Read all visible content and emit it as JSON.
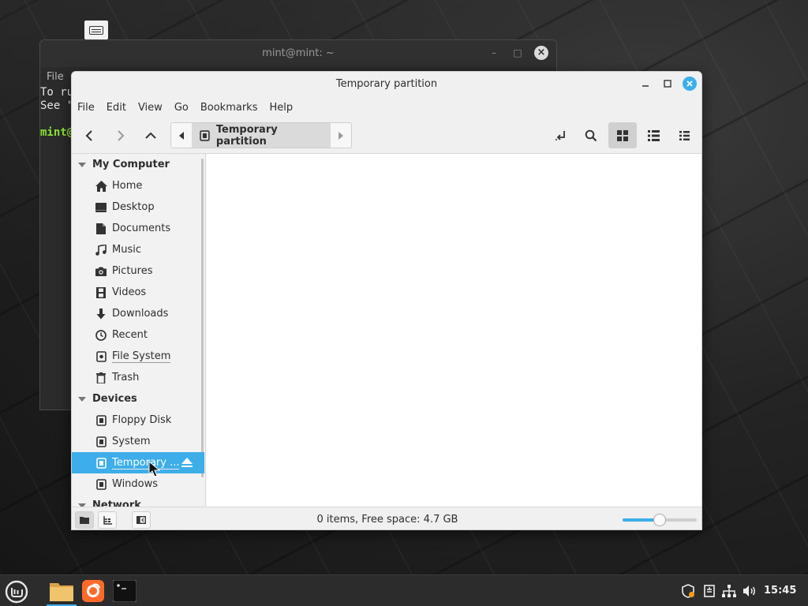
{
  "terminal": {
    "title": "mint@mint: ~",
    "menu_file": "File",
    "line1": "To ru",
    "line2": "See \"",
    "prompt": "mint@"
  },
  "window": {
    "title": "Temporary partition"
  },
  "menubar": {
    "items": [
      "File",
      "Edit",
      "View",
      "Go",
      "Bookmarks",
      "Help"
    ]
  },
  "toolbar": {
    "path_current": "Temporary partition",
    "active_view": "icon-view"
  },
  "sidebar": {
    "sections": [
      {
        "label": "My Computer",
        "items": [
          {
            "label": "Home",
            "icon": "home-icon"
          },
          {
            "label": "Desktop",
            "icon": "desktop-icon"
          },
          {
            "label": "Documents",
            "icon": "documents-icon"
          },
          {
            "label": "Music",
            "icon": "music-icon"
          },
          {
            "label": "Pictures",
            "icon": "camera-icon"
          },
          {
            "label": "Videos",
            "icon": "film-icon"
          },
          {
            "label": "Downloads",
            "icon": "download-arrow-icon"
          },
          {
            "label": "Recent",
            "icon": "clock-icon"
          },
          {
            "label": "File System",
            "icon": "drive-icon"
          },
          {
            "label": "Trash",
            "icon": "trash-icon"
          }
        ]
      },
      {
        "label": "Devices",
        "items": [
          {
            "label": "Floppy Disk",
            "icon": "drive-icon"
          },
          {
            "label": "System",
            "icon": "drive-icon"
          },
          {
            "label": "Temporary ...",
            "icon": "drive-icon",
            "selected": true
          },
          {
            "label": "Windows",
            "icon": "drive-icon"
          }
        ]
      },
      {
        "label": "Network",
        "items": []
      }
    ]
  },
  "status": {
    "text": "0 items, Free space: 4.7 GB",
    "zoom_level": 0.5
  },
  "taskbar": {
    "clock": "15:45",
    "apps": [
      "file-manager-icon",
      "firefox-icon",
      "terminal-icon"
    ],
    "tray": [
      "shield-update-icon",
      "clipboard-icon",
      "network-icon",
      "volume-icon"
    ]
  },
  "colors": {
    "accent": "#3daee9",
    "terminal_prompt": "#8ae234"
  }
}
